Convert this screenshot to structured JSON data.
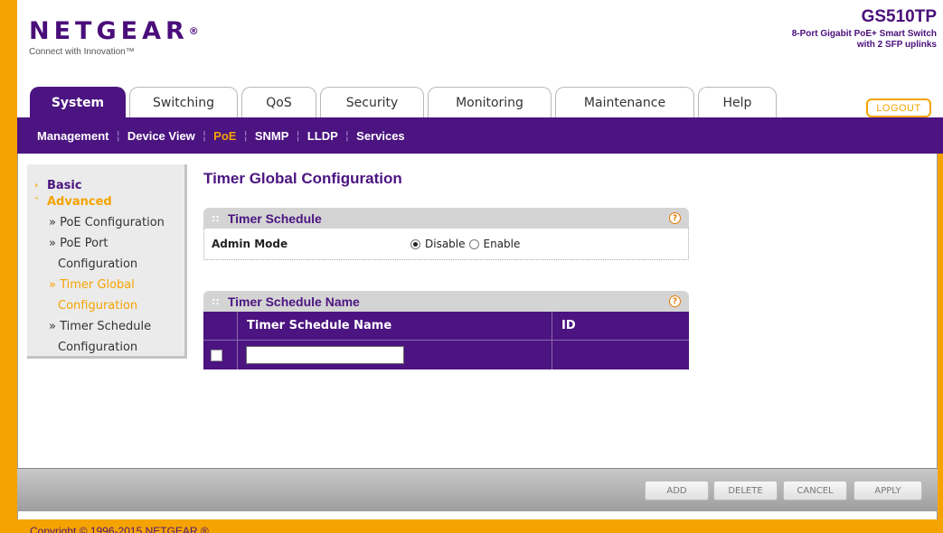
{
  "brand": {
    "logo": "NETGEAR",
    "logo_mark": "®",
    "tagline": "Connect with Innovation™",
    "model": "GS510TP",
    "model_desc_1": "8-Port Gigabit PoE+ Smart Switch",
    "model_desc_2": "with 2 SFP uplinks"
  },
  "tabs": [
    {
      "label": "System",
      "active": true
    },
    {
      "label": "Switching",
      "active": false
    },
    {
      "label": "QoS",
      "active": false
    },
    {
      "label": "Security",
      "active": false
    },
    {
      "label": "Monitoring",
      "active": false
    },
    {
      "label": "Maintenance",
      "active": false
    },
    {
      "label": "Help",
      "active": false
    }
  ],
  "logout_label": "LOGOUT",
  "subnav": [
    {
      "label": "Management",
      "active": false
    },
    {
      "label": "Device View",
      "active": false
    },
    {
      "label": "PoE",
      "active": true
    },
    {
      "label": "SNMP",
      "active": false
    },
    {
      "label": "LLDP",
      "active": false
    },
    {
      "label": "Services",
      "active": false
    }
  ],
  "sidebar": {
    "basic": "Basic",
    "advanced": "Advanced",
    "items": [
      "» PoE Configuration",
      "» PoE Port",
      "Configuration",
      "» Timer Global",
      "Configuration",
      "» Timer Schedule",
      "Configuration"
    ]
  },
  "page_title": "Timer Global Configuration",
  "panel1": {
    "title": "Timer Schedule",
    "admin_label": "Admin Mode",
    "disable_label": "Disable",
    "enable_label": "Enable",
    "selected": "Disable"
  },
  "panel2": {
    "title": "Timer Schedule Name",
    "col_name": "Timer Schedule Name",
    "col_id": "ID",
    "input_value": ""
  },
  "buttons": {
    "add": "ADD",
    "delete": "DELETE",
    "cancel": "CANCEL",
    "apply": "APPLY"
  },
  "copyright": "Copyright © 1996-2015 NETGEAR ®",
  "colors": {
    "brand_purple": "#4b1480",
    "accent_orange": "#f5a300"
  }
}
